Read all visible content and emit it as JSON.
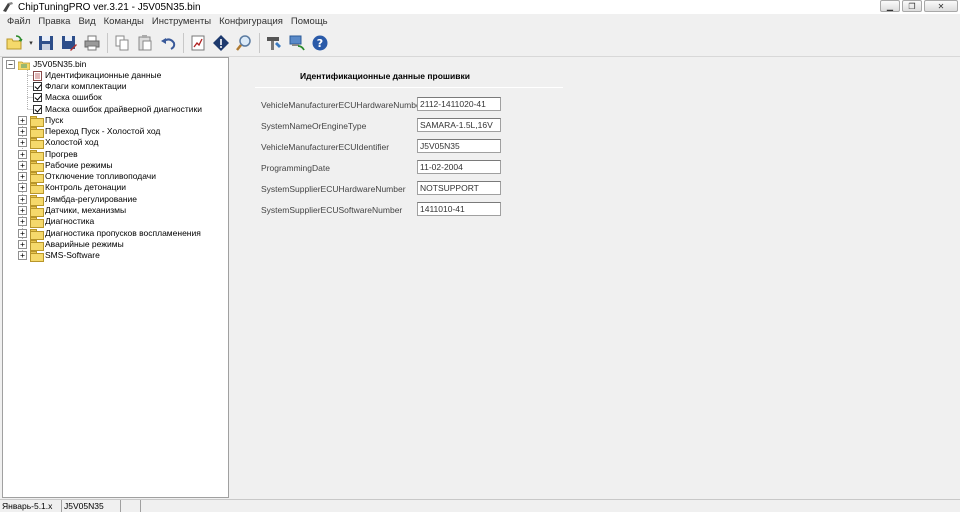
{
  "window": {
    "title": "ChipTuningPRO ver.3.21 - J5V05N35.bin",
    "controls": [
      "minimize",
      "maximize",
      "close"
    ]
  },
  "menu": {
    "items": [
      "Файл",
      "Правка",
      "Вид",
      "Команды",
      "Инструменты",
      "Конфигурация",
      "Помощь"
    ]
  },
  "toolbar": {
    "buttons": [
      {
        "name": "open-icon"
      },
      {
        "name": "save-icon"
      },
      {
        "name": "save-as-icon"
      },
      {
        "name": "print-icon"
      },
      {
        "name": "copy-icon"
      },
      {
        "name": "paste-icon"
      },
      {
        "name": "undo-icon"
      },
      {
        "name": "chart-icon"
      },
      {
        "name": "diamond-icon"
      },
      {
        "name": "search-icon"
      },
      {
        "name": "tools-icon"
      },
      {
        "name": "ecu-connect-icon"
      },
      {
        "name": "help-icon"
      }
    ]
  },
  "tree": {
    "root": "J5V05N35.bin",
    "leaves": [
      {
        "label": "Идентификационные данные",
        "type": "doc"
      },
      {
        "label": "Флаги комплектации",
        "type": "check",
        "checked": true
      },
      {
        "label": "Маска ошибок",
        "type": "check",
        "checked": true
      },
      {
        "label": "Маска ошибок драйверной диагностики",
        "type": "check",
        "checked": true
      }
    ],
    "folders": [
      "Пуск",
      "Переход Пуск - Холостой ход",
      "Холостой ход",
      "Прогрев",
      "Рабочие режимы",
      "Отключение топливоподачи",
      "Контроль детонации",
      "Лямбда-регулирование",
      "Датчики, механизмы",
      "Диагностика",
      "Диагностика пропусков воспламенения",
      "Аварийные режимы",
      "SMS-Software"
    ],
    "expander_symbol": "+",
    "collapse_symbol": "−"
  },
  "content": {
    "title": "Идентификационные данные прошивки",
    "fields": [
      {
        "label": "VehicleManufacturerECUHardwareNumber",
        "value": "2112-1411020-41"
      },
      {
        "label": "SystemNameOrEngineType",
        "value": "SAMARA-1.5L,16V"
      },
      {
        "label": "VehicleManufacturerECUIdentifier",
        "value": "J5V05N35"
      },
      {
        "label": "ProgrammingDate",
        "value": "11-02-2004"
      },
      {
        "label": "SystemSupplierECUHardwareNumber",
        "value": "NOTSUPPORT"
      },
      {
        "label": "SystemSupplierECUSoftwareNumber",
        "value": "1411010-41"
      }
    ]
  },
  "status": {
    "cells": [
      "Январь-5.1.x",
      "J5V05N35",
      ""
    ]
  },
  "colors": {
    "folder": "#f5d96b",
    "pane_bg": "#ffffff",
    "chrome_bg": "#f0f0f0"
  }
}
